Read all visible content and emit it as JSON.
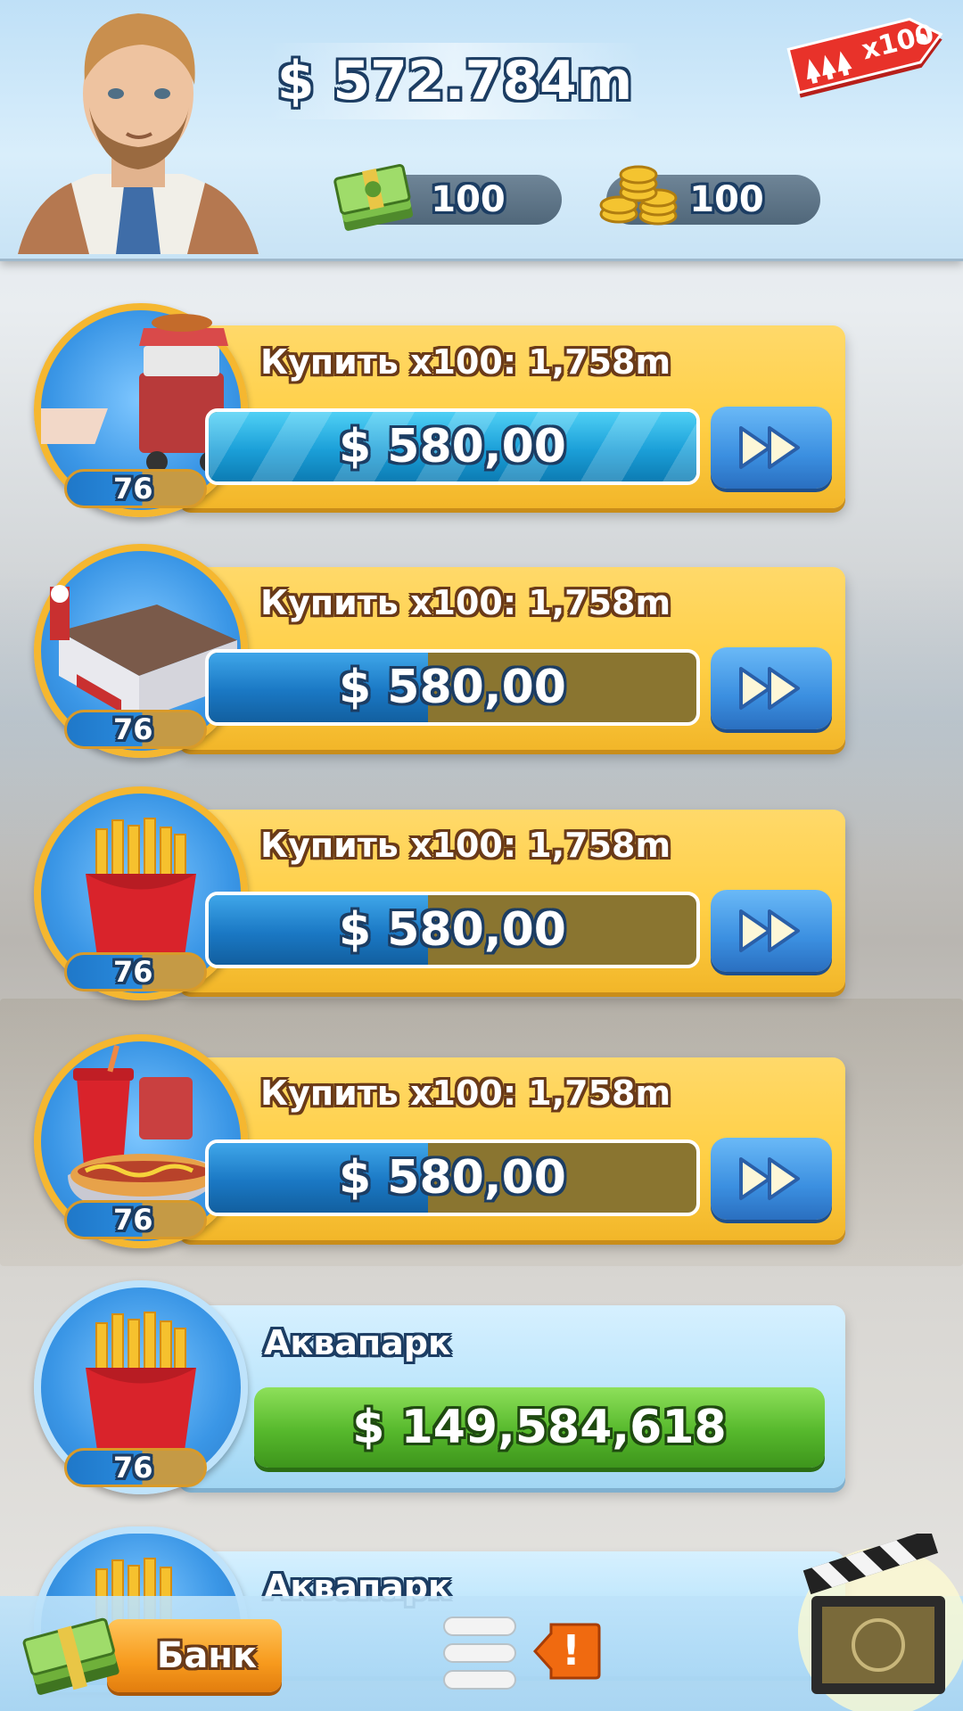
{
  "header": {
    "balance": "$ 572.784m",
    "cash_count": "100",
    "coins_count": "100",
    "multiplier": "x100"
  },
  "businesses": [
    {
      "icon": "hot-dog-cart-icon",
      "level": "76",
      "buy_label": "Купить x100: 1,758m",
      "price": "$ 580,00",
      "progress": 1.0
    },
    {
      "icon": "diner-icon",
      "level": "76",
      "buy_label": "Купить x100: 1,758m",
      "price": "$ 580,00",
      "progress": 0.45
    },
    {
      "icon": "french-fries-icon",
      "level": "76",
      "buy_label": "Купить x100: 1,758m",
      "price": "$ 580,00",
      "progress": 0.45
    },
    {
      "icon": "soda-hotdog-icon",
      "level": "76",
      "buy_label": "Купить x100: 1,758m",
      "price": "$ 580,00",
      "progress": 0.45
    }
  ],
  "locked_businesses": [
    {
      "icon": "french-fries-icon",
      "level": "76",
      "name": "Аквапарк",
      "price": "$ 149,584,618"
    },
    {
      "icon": "french-fries-icon",
      "name": "Аквапарк"
    }
  ],
  "bottom_bar": {
    "bank_label": "Банк",
    "alert_symbol": "!"
  },
  "colors": {
    "card_yellow": "#ffcf45",
    "card_blue": "#b9e4fb",
    "progress_blue": "#1a78c4",
    "buy_green": "#56b82c",
    "bank_orange": "#f79a1d",
    "tag_red": "#e8322a"
  }
}
